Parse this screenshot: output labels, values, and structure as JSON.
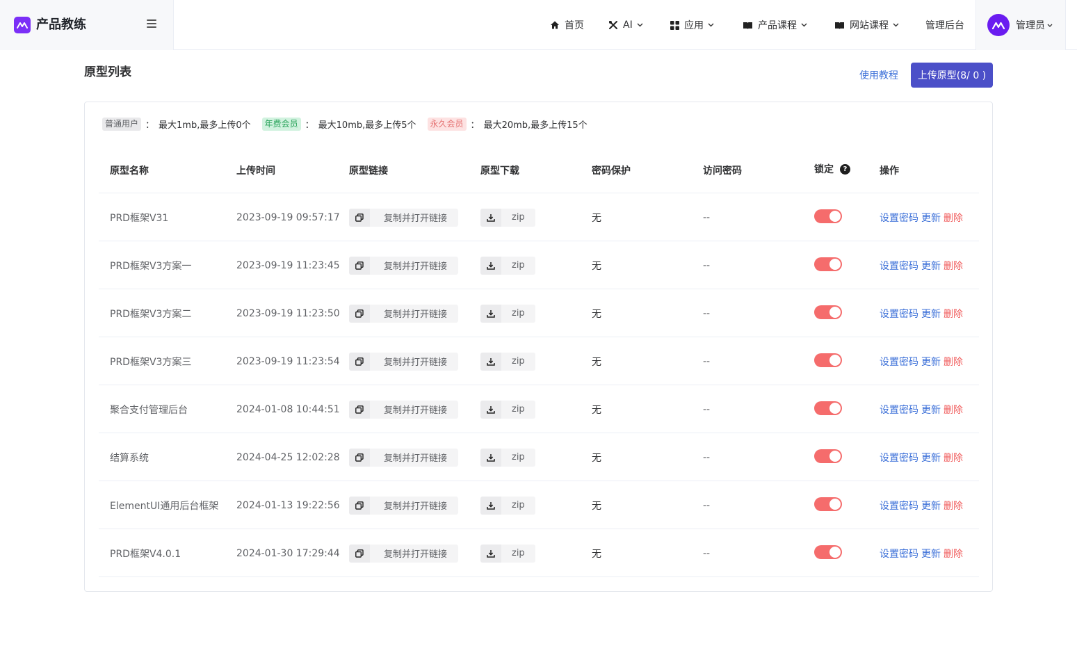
{
  "brand": {
    "name": "产品教练"
  },
  "nav": {
    "home": "首页",
    "ai": "AI",
    "apps": "应用",
    "product_course": "产品课程",
    "site_course": "网站课程",
    "admin": "管理后台",
    "user": "管理员"
  },
  "page": {
    "title": "原型列表",
    "tutorial": "使用教程",
    "upload": "上传原型(8/ 0 )"
  },
  "quota": [
    {
      "tag": "普通用户",
      "text": "最大1mb,最多上传0个"
    },
    {
      "tag": "年费会员",
      "text": "最大10mb,最多上传5个"
    },
    {
      "tag": "永久会员",
      "text": "最大20mb,最多上传15个"
    }
  ],
  "colon": "：",
  "table": {
    "headers": [
      "原型名称",
      "上传时间",
      "原型链接",
      "原型下载",
      "密码保护",
      "访问密码",
      "锁定",
      "操作"
    ],
    "copy_label": "复制并打开链接",
    "zip_label": "zip",
    "actions": {
      "set_password": "设置密码",
      "update": "更新",
      "delete": "删除"
    },
    "rows": [
      {
        "name": "PRD框架V31",
        "time": "2023-09-19 09:57:17",
        "protect": "无",
        "password": "--",
        "locked": true
      },
      {
        "name": "PRD框架V3方案一",
        "time": "2023-09-19 11:23:45",
        "protect": "无",
        "password": "--",
        "locked": true
      },
      {
        "name": "PRD框架V3方案二",
        "time": "2023-09-19 11:23:50",
        "protect": "无",
        "password": "--",
        "locked": true
      },
      {
        "name": "PRD框架V3方案三",
        "time": "2023-09-19 11:23:54",
        "protect": "无",
        "password": "--",
        "locked": true
      },
      {
        "name": "聚合支付管理后台",
        "time": "2024-01-08 10:44:51",
        "protect": "无",
        "password": "--",
        "locked": true
      },
      {
        "name": "结算系统",
        "time": "2024-04-25 12:02:28",
        "protect": "无",
        "password": "--",
        "locked": true
      },
      {
        "name": "ElementUI通用后台框架",
        "time": "2024-01-13 19:22:56",
        "protect": "无",
        "password": "--",
        "locked": true
      },
      {
        "name": "PRD框架V4.0.1",
        "time": "2024-01-30 17:29:44",
        "protect": "无",
        "password": "--",
        "locked": true
      }
    ]
  },
  "colors": {
    "primary": "#4b4fc8",
    "brand": "#7b2ff7",
    "link": "#3b6fd8",
    "danger": "#f05a5a",
    "switch_on": "#f56c6c"
  }
}
